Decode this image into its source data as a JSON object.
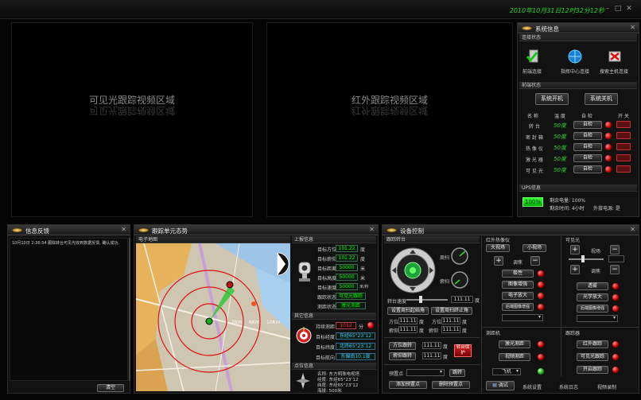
{
  "header": {
    "datetime": "2010年10月31日12时32分12秒"
  },
  "video": {
    "visible_label": "可见光跟踪视频区域",
    "infrared_label": "红外跟踪视频区域"
  },
  "sysinfo": {
    "title": "系统信息",
    "conn_label": "连接状态",
    "conns": [
      "前端连接",
      "指挥中心连接",
      "搜索主机连接"
    ],
    "front_label": "前端状态",
    "power_on": "系统开机",
    "power_off": "系统关机",
    "cols": [
      "名 称",
      "温 度",
      "自 检",
      "开 关"
    ],
    "rows": [
      {
        "name": "转 台",
        "temp": "50度",
        "check": "自检"
      },
      {
        "name": "密 封 箱",
        "temp": "50度",
        "check": "自检"
      },
      {
        "name": "热 像 仪",
        "temp": "50度",
        "check": "自检"
      },
      {
        "name": "激 光 器",
        "temp": "50度",
        "check": "自检"
      },
      {
        "name": "可 见 光",
        "temp": "50度",
        "check": "自检"
      }
    ],
    "ups_label": "UPS信息",
    "ups_pct": "100%",
    "ups_remaining": "剩余电量: 100%",
    "ups_time": "剩余时间: 4小时",
    "ups_mode": "外接电源: 是"
  },
  "feedback": {
    "title": "信息反馈",
    "message": "10月10日 2:36:54 跟踪转台可见光收到数据反馈, 确认成功.",
    "clear": "清空"
  },
  "tracking": {
    "title": "跟踪单元态势",
    "map_label": "电子地图",
    "report_label": "上报信息",
    "report_rows": [
      {
        "label": "目标方位",
        "value": "101.22",
        "unit": "度"
      },
      {
        "label": "目标俯仰",
        "value": "101.22",
        "unit": "度"
      },
      {
        "label": "目标距离",
        "value": "50000",
        "unit": "米"
      },
      {
        "label": "目标高度",
        "value": "50000",
        "unit": "米"
      },
      {
        "label": "目标速度",
        "value": "50000",
        "unit": "米/秒"
      },
      {
        "label": "跟踪状态",
        "value": "可见光跟踪",
        "unit": ""
      },
      {
        "label": "测距状态",
        "value": "激光测距",
        "unit": ""
      }
    ],
    "other_label": "其它信息",
    "other_rows": [
      {
        "label": "持续测距",
        "value": "1012",
        "unit": "分"
      },
      {
        "label": "目标经度",
        "value": "东经65°23″12",
        "unit": ""
      },
      {
        "label": "目标纬度",
        "value": "北纬65°23″12",
        "unit": ""
      },
      {
        "label": "目标航向",
        "value": "东偏南10.1度",
        "unit": ""
      }
    ],
    "point_label": "点位信息",
    "point_name": "名称: 东方明珠电视塔",
    "point_lon": "经度: 东经65°23″12",
    "point_lat": "纬度: 东经65°23″12",
    "point_height": "海拔: 500米",
    "ring_labels": [
      "2Km",
      "6Km",
      "10Km"
    ]
  },
  "device": {
    "title": "设备控制",
    "turret_label": "跟踪转台",
    "azimuth": "周扫",
    "elevation": "俯扫",
    "speed_label": "转台速度",
    "speed_value": "111.11",
    "speed_unit": "度",
    "set_scan_start": "设置周扫起始角",
    "set_scan_end": "设置周扫终止角",
    "az_label": "方位",
    "el_label": "俯仰",
    "az_value": "111.11",
    "el_value": "111.11",
    "az2_value": "111.11",
    "el2_value": "111.11",
    "deg": "度",
    "dir_track": "方位跟转",
    "pitch_track": "俯仰跟转",
    "dir_value": "111.11",
    "pitch_value": "111.11",
    "protect": "转台保护",
    "preset_label": "预置点",
    "jump": "跳转",
    "add_preset": "添加预置点",
    "del_preset": "删除预置点",
    "ir_label": "红外热像仪",
    "big_fov": "大视场",
    "small_fov": "小视场",
    "focus": "调焦",
    "ir_btns": [
      "极性",
      "图像增强",
      "电子放大",
      "后端图像增强"
    ],
    "vis_label": "可见光",
    "zoom": "视场",
    "vis_focus": "调焦",
    "vis_btns": [
      "透雾",
      "光学放大",
      "后端图像增强"
    ],
    "laser_label": "测距机",
    "laser_measure": "激光测距",
    "laser_mode": "视频测距",
    "fly": "飞机",
    "tracker_label": "跟踪器",
    "ir_track": "红外跟踪",
    "vis_track": "可见光跟踪",
    "open_track": "开启跟踪",
    "debug": "调试",
    "sys_set": "系统设置",
    "sys_log": "系统日志",
    "video_rec": "视频录制"
  }
}
